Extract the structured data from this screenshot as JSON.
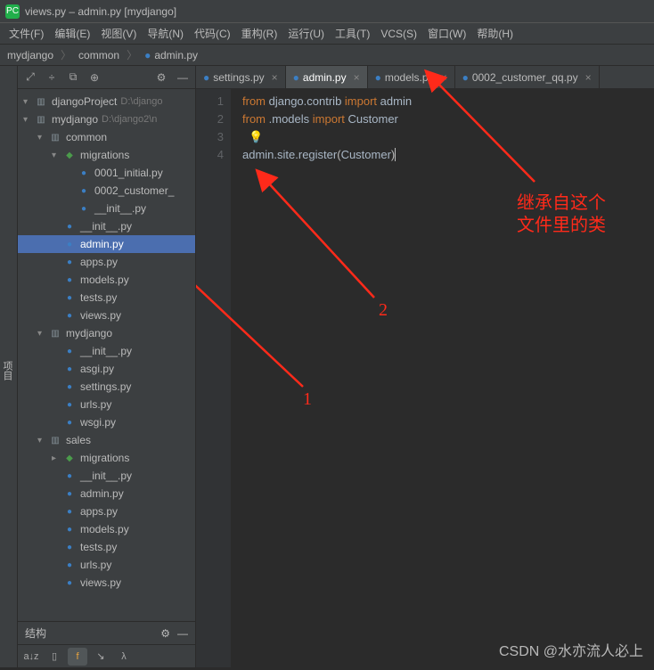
{
  "titlebar": {
    "text": "views.py – admin.py [mydjango]"
  },
  "menus": [
    "文件(F)",
    "编辑(E)",
    "视图(V)",
    "导航(N)",
    "代码(C)",
    "重构(R)",
    "运行(U)",
    "工具(T)",
    "VCS(S)",
    "窗口(W)",
    "帮助(H)"
  ],
  "breadcrumbs": [
    "mydjango",
    "common",
    "admin.py"
  ],
  "sidebar_tab": "项目",
  "tabs": [
    {
      "label": "settings.py",
      "active": false
    },
    {
      "label": "admin.py",
      "active": true
    },
    {
      "label": "models.py",
      "active": false
    },
    {
      "label": "0002_customer_qq.py",
      "active": false
    }
  ],
  "tree": [
    {
      "depth": 0,
      "arrow": "▾",
      "icon": "folder",
      "name": "djangoProject",
      "path": "D:\\django"
    },
    {
      "depth": 0,
      "arrow": "▾",
      "icon": "folder",
      "name": "mydjango",
      "path": "D:\\django2\\n"
    },
    {
      "depth": 1,
      "arrow": "▾",
      "icon": "folder",
      "name": "common"
    },
    {
      "depth": 2,
      "arrow": "▾",
      "icon": "dj",
      "name": "migrations"
    },
    {
      "depth": 3,
      "arrow": "",
      "icon": "py",
      "name": "0001_initial.py"
    },
    {
      "depth": 3,
      "arrow": "",
      "icon": "py",
      "name": "0002_customer_"
    },
    {
      "depth": 3,
      "arrow": "",
      "icon": "py",
      "name": "__init__.py"
    },
    {
      "depth": 2,
      "arrow": "",
      "icon": "py",
      "name": "__init__.py"
    },
    {
      "depth": 2,
      "arrow": "",
      "icon": "py",
      "name": "admin.py",
      "selected": true
    },
    {
      "depth": 2,
      "arrow": "",
      "icon": "py",
      "name": "apps.py"
    },
    {
      "depth": 2,
      "arrow": "",
      "icon": "py",
      "name": "models.py"
    },
    {
      "depth": 2,
      "arrow": "",
      "icon": "py",
      "name": "tests.py"
    },
    {
      "depth": 2,
      "arrow": "",
      "icon": "py",
      "name": "views.py"
    },
    {
      "depth": 1,
      "arrow": "▾",
      "icon": "folder",
      "name": "mydjango"
    },
    {
      "depth": 2,
      "arrow": "",
      "icon": "py",
      "name": "__init__.py"
    },
    {
      "depth": 2,
      "arrow": "",
      "icon": "py",
      "name": "asgi.py"
    },
    {
      "depth": 2,
      "arrow": "",
      "icon": "py",
      "name": "settings.py"
    },
    {
      "depth": 2,
      "arrow": "",
      "icon": "py",
      "name": "urls.py"
    },
    {
      "depth": 2,
      "arrow": "",
      "icon": "py",
      "name": "wsgi.py"
    },
    {
      "depth": 1,
      "arrow": "▾",
      "icon": "folder",
      "name": "sales"
    },
    {
      "depth": 2,
      "arrow": "▸",
      "icon": "dj",
      "name": "migrations"
    },
    {
      "depth": 2,
      "arrow": "",
      "icon": "py",
      "name": "__init__.py"
    },
    {
      "depth": 2,
      "arrow": "",
      "icon": "py",
      "name": "admin.py"
    },
    {
      "depth": 2,
      "arrow": "",
      "icon": "py",
      "name": "apps.py"
    },
    {
      "depth": 2,
      "arrow": "",
      "icon": "py",
      "name": "models.py"
    },
    {
      "depth": 2,
      "arrow": "",
      "icon": "py",
      "name": "tests.py"
    },
    {
      "depth": 2,
      "arrow": "",
      "icon": "py",
      "name": "urls.py"
    },
    {
      "depth": 2,
      "arrow": "",
      "icon": "py",
      "name": "views.py"
    }
  ],
  "structure_label": "结构",
  "code": {
    "line1_kw1": "from",
    "line1_mod": "django.contrib",
    "line1_kw2": "import",
    "line1_id": "admin",
    "line2_kw1": "from",
    "line2_mod": ".models",
    "line2_kw2": "import",
    "line2_id": "Customer",
    "line4": "admin.site.register",
    "line4_arg": "Customer"
  },
  "gutter": [
    "1",
    "2",
    "3",
    "4"
  ],
  "annotations": {
    "label1": "1",
    "label2": "2",
    "text1": "继承自这个",
    "text2": "文件里的类"
  },
  "watermark": "CSDN @水亦流人必上"
}
